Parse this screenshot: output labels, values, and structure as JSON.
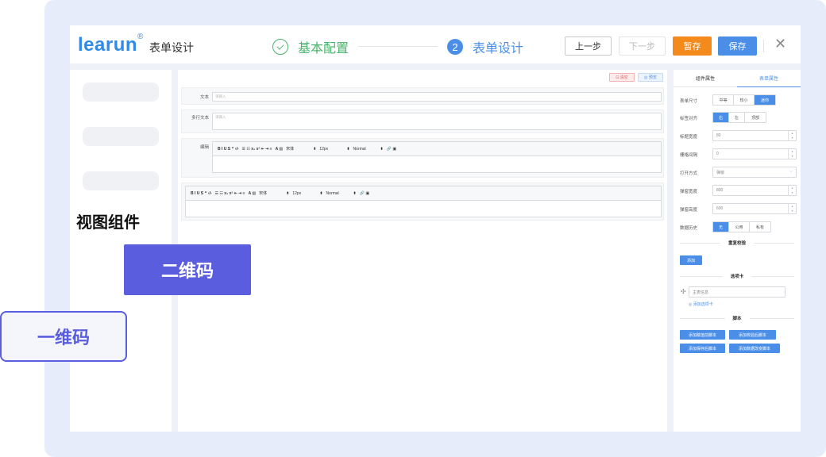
{
  "header": {
    "logo": "learun",
    "logo_mark": "®",
    "app_title": "表单设计",
    "steps": [
      {
        "label": "基本配置",
        "state": "done"
      },
      {
        "number": "2",
        "label": "表单设计",
        "state": "active"
      }
    ],
    "buttons": {
      "prev": "上一步",
      "next": "下一步",
      "draft": "暂存",
      "save": "保存"
    },
    "close_icon": "close-icon"
  },
  "canvas": {
    "clear_label": "⊡ 清空",
    "preview_label": "◎ 预览",
    "fields": [
      {
        "label": "文本",
        "placeholder": "请输入"
      },
      {
        "label": "多行文本",
        "placeholder": "请输入"
      },
      {
        "label": "编辑"
      }
    ],
    "toolbar": {
      "format_icons": "B  I  U  S  ❞  ‹/›",
      "list_icons": "☰  ☷  x₂  x²  ⇤  ⇥  ≡",
      "color_icons": "A  ▧",
      "font": "宋体",
      "size": "12px",
      "heading": "Normal",
      "insert_icons": "🔗  ▣"
    }
  },
  "props": {
    "tabs": [
      "组件属性",
      "表单属性"
    ],
    "size_label": "表单尺寸",
    "size_options": [
      "中等",
      "较小",
      "迷你"
    ],
    "align_label": "标签对齐",
    "align_options": [
      "右",
      "左",
      "顶部"
    ],
    "label_width_label": "标题宽度",
    "label_width": "80",
    "gutter_label": "栅格间隔",
    "gutter": "0",
    "open_label": "打开方式",
    "open_value": "弹窗",
    "dialog_width_label": "弹窗宽度",
    "dialog_width": "800",
    "dialog_height_label": "弹窗高度",
    "dialog_height": "600",
    "history_label": "数据历史",
    "history_options": [
      "无",
      "公用",
      "私有"
    ],
    "dup_section": "重复校验",
    "add_button": "添加",
    "tab_section": "选项卡",
    "tab_item": "主表信息",
    "add_tab": "◎ 添加选项卡",
    "script_section": "脚本",
    "script_buttons": [
      "添加赋值前脚本",
      "添加校验后脚本",
      "添加保存后脚本",
      "添加数据改变脚本"
    ]
  },
  "overlay": {
    "view_label": "视图组件",
    "qr_button": "二维码",
    "barcode_button": "一维码"
  }
}
